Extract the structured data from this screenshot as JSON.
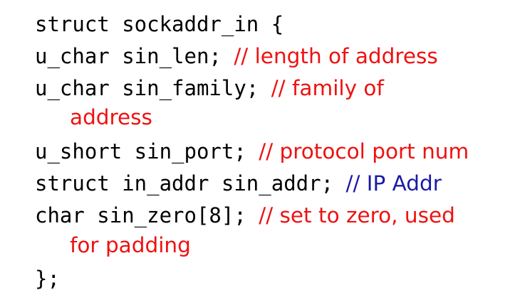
{
  "colors": {
    "code": "#000000",
    "comment_red": "#ee1111",
    "comment_blue": "#1a1aa8"
  },
  "code_lines": [
    {
      "code": "struct sockaddr_in {",
      "comment": ""
    },
    {
      "code": "u_char sin_len; ",
      "comment": "// length of address"
    },
    {
      "code": "u_char sin_family; ",
      "comment": "// family of"
    },
    {
      "code": "",
      "comment": "address"
    },
    {
      "code": "u_short sin_port; ",
      "comment": "// protocol port num"
    },
    {
      "code": "struct in_addr sin_addr; ",
      "comment": "// IP Addr"
    },
    {
      "code": "char sin_zero[8]; ",
      "comment": "// set to zero, used"
    },
    {
      "code": "",
      "comment": "for padding"
    },
    {
      "code": "};",
      "comment": ""
    }
  ]
}
